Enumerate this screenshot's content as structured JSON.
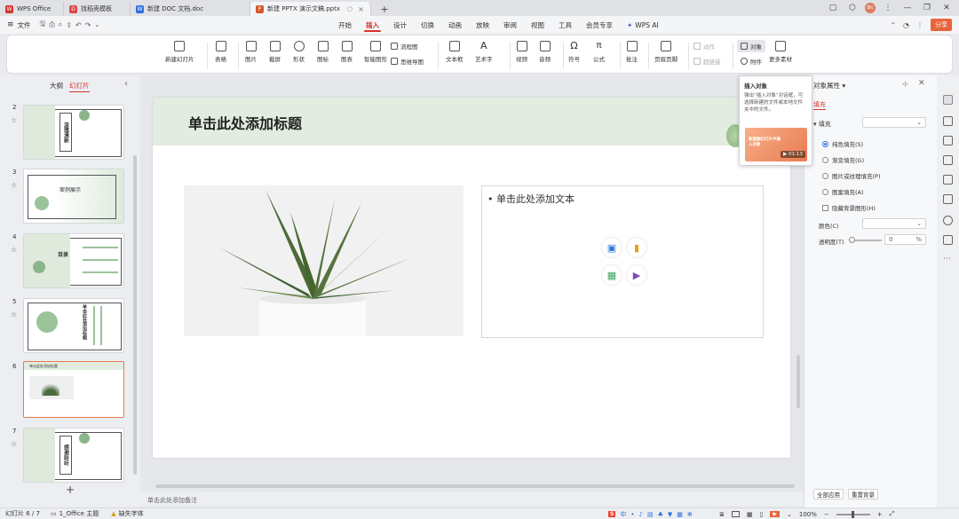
{
  "titlebar": {
    "tabs": [
      {
        "label": "WPS Office"
      },
      {
        "label": "找稻壳模板"
      },
      {
        "label": "新建 DOC 文档.doc"
      },
      {
        "label": "新建 PPTX 演示文稿.pptx"
      }
    ],
    "new_tab": "+",
    "avatar": "Bit"
  },
  "menubar": {
    "file_label": "文件",
    "tabs": [
      "开始",
      "插入",
      "设计",
      "切换",
      "动画",
      "放映",
      "审阅",
      "视图",
      "工具",
      "会员专享"
    ],
    "active_tab": "插入",
    "ai_label": "WPS AI",
    "share_label": "分享"
  },
  "ribbon": {
    "new_slide": "新建幻灯片",
    "table": "表格",
    "picture": "图片",
    "screenshot": "截屏",
    "shape": "形状",
    "icon": "图标",
    "chart": "图表",
    "smartart": "智能图形",
    "flowchart": "流程图",
    "mindmap": "思维导图",
    "textbox": "文本框",
    "wordart": "艺术字",
    "video": "视频",
    "audio": "音频",
    "symbol": "符号",
    "formula": "公式",
    "comment": "批注",
    "header_footer": "页眉页脚",
    "action": "动作",
    "hyperlink": "超链接",
    "object": "对象",
    "attachment": "附件",
    "more": "更多素材"
  },
  "leftpanel": {
    "tab_outline": "大纲",
    "tab_slides": "幻灯片",
    "slides": [
      {
        "num": "2",
        "title": "淡雅清新"
      },
      {
        "num": "3",
        "title": "案例展示"
      },
      {
        "num": "4",
        "title": "目录"
      },
      {
        "num": "5",
        "title": "单击此处添加标题"
      },
      {
        "num": "6",
        "title": "单击此处添加标题"
      },
      {
        "num": "7",
        "title": "感谢聆听"
      }
    ],
    "add": "+"
  },
  "slide": {
    "title": "单击此处添加标题",
    "bullet": "单击此处添加文本"
  },
  "notes_placeholder": "单击此处添加备注",
  "tooltip": {
    "title": "插入对象",
    "desc": "弹出“插入对象”对话框，可选择新建的文件或本地文件夹中的文件。",
    "video_text": "新建副幻灯片中插入对象",
    "duration": "01:13"
  },
  "rightpanel": {
    "title": "对象属性",
    "tab_fill": "填充",
    "section_fill": "填充",
    "options": [
      "纯色填充(S)",
      "渐变填充(G)",
      "图片或纹理填充(P)",
      "图案填充(A)"
    ],
    "checkbox": "隐藏背景图形(H)",
    "color_label": "颜色(C)",
    "transparency_label": "透明度(T)",
    "transparency_value": "0",
    "transparency_unit": "%",
    "apply_all": "全部应用",
    "reset_bg": "重置背景"
  },
  "statusbar": {
    "slide_info": "幻灯片 6 / 7",
    "theme": "1_Office 主题",
    "missing_font": "缺失字体",
    "zoom": "100%"
  },
  "colors": {
    "accent_red": "#d6332c",
    "slide_header_bg": "#e2ece0",
    "selected_border": "#e8794a"
  }
}
